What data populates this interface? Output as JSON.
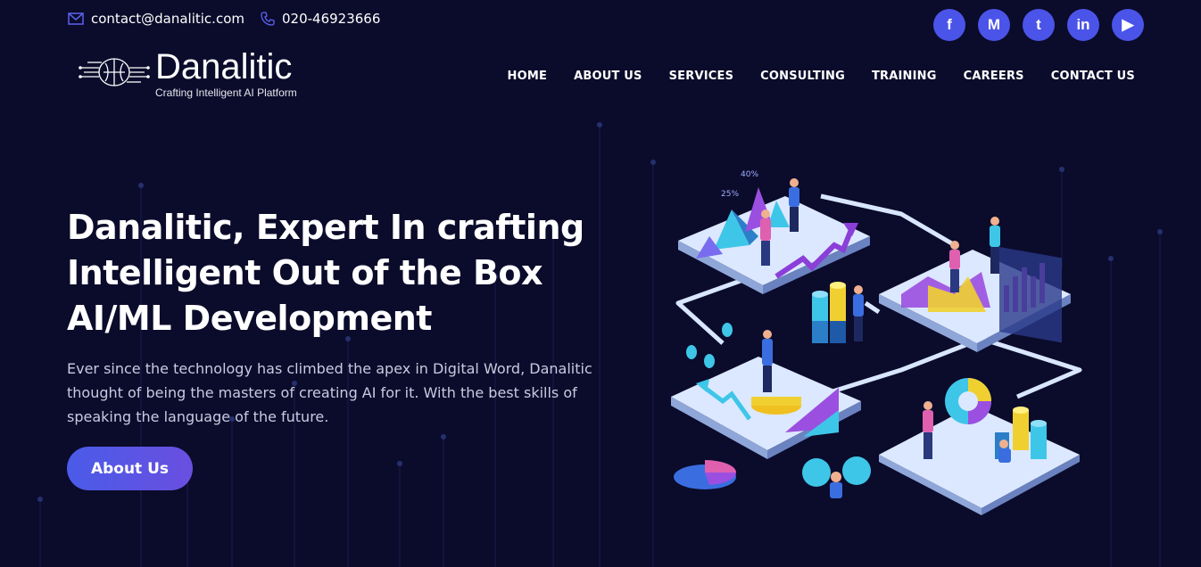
{
  "contact": {
    "email": "contact@danalitic.com",
    "phone": "020-46923666",
    "email_icon": "mail-icon",
    "phone_icon": "phone-icon"
  },
  "socials": [
    {
      "name": "facebook",
      "glyph": "f"
    },
    {
      "name": "medium",
      "glyph": "M"
    },
    {
      "name": "twitter",
      "glyph": "t"
    },
    {
      "name": "linkedin",
      "glyph": "in"
    },
    {
      "name": "youtube",
      "glyph": "▶"
    }
  ],
  "logo": {
    "brand": "Danalitic",
    "tagline": "Crafting Intelligent AI Platform"
  },
  "nav": [
    "HOME",
    "ABOUT US",
    "SERVICES",
    "CONSULTING",
    "TRAINING",
    "CAREERS",
    "CONTACT US"
  ],
  "hero": {
    "title": "Danalitic, Expert In crafting Intelligent Out of the Box AI/ML Development",
    "text": "Ever since the technology has climbed the apex in Digital Word, Danalitic thought of being the masters of creating AI for it. With the best skills of speaking the language of the future.",
    "button": "About Us"
  },
  "illustration": {
    "label_25": "25%",
    "label_40": "40%"
  },
  "colors": {
    "background": "#0b0b2b",
    "accent": "#4b54e8",
    "text_muted": "#c9cbe0"
  }
}
